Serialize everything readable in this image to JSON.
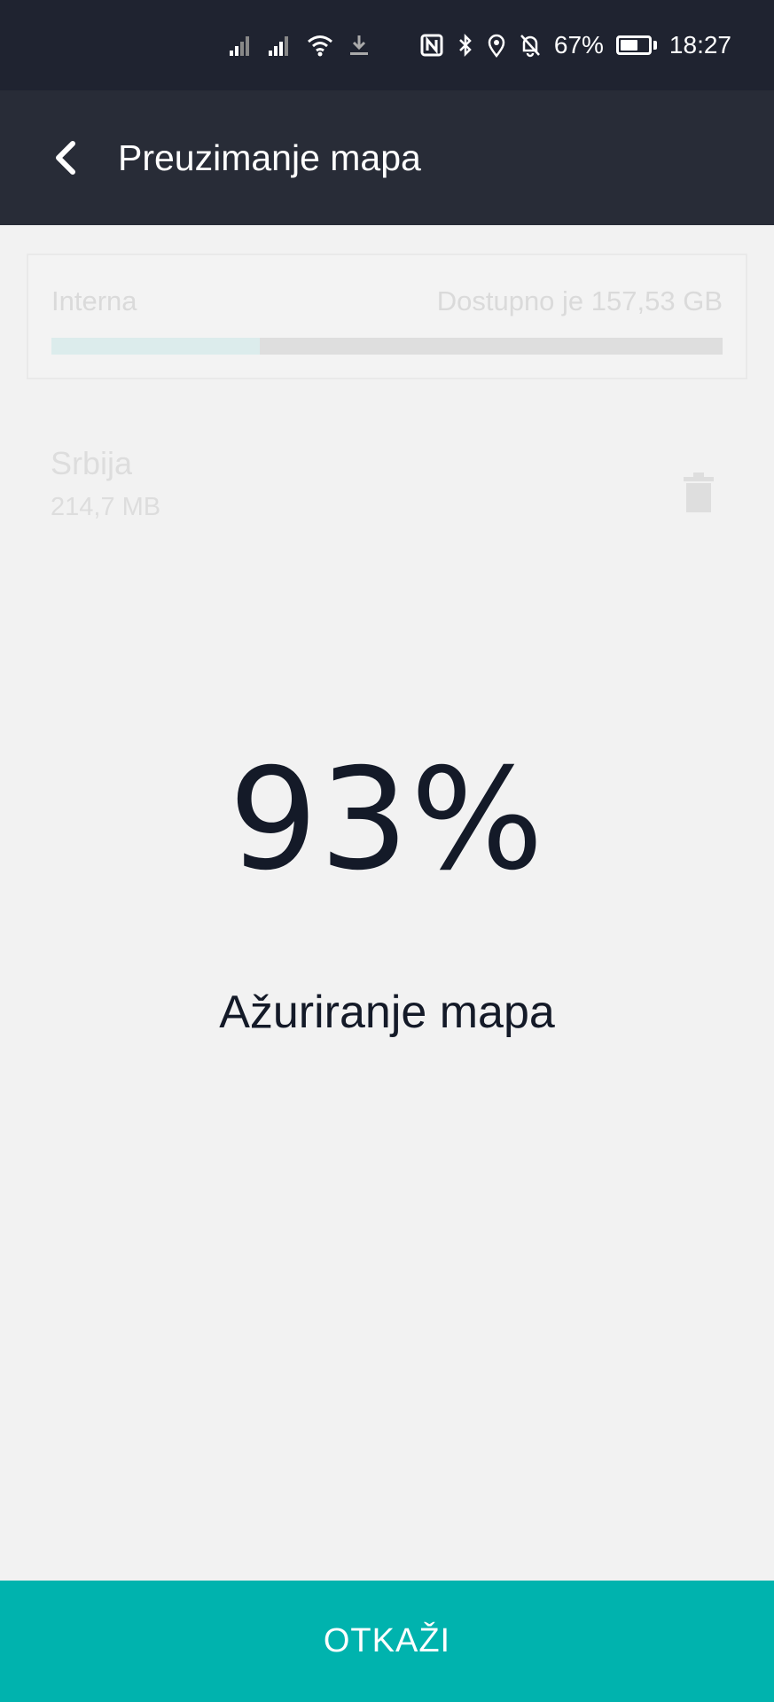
{
  "status_bar": {
    "battery_percent": "67%",
    "battery_level": 0.67,
    "time": "18:27",
    "icons": [
      "signal-icon",
      "signal-icon",
      "wifi-icon",
      "download-icon",
      "nfc-icon",
      "bluetooth-icon",
      "location-icon",
      "notifications-off-icon",
      "battery-icon"
    ]
  },
  "app_bar": {
    "back_icon": "chevron-left-icon",
    "title": "Preuzimanje mapa"
  },
  "storage": {
    "label": "Interna",
    "available": "Dostupno je 157,53 GB",
    "used_fraction": 0.31
  },
  "map_item": {
    "name": "Srbija",
    "size": "214,7 MB",
    "delete_icon": "trash-icon"
  },
  "progress": {
    "percent": "93%",
    "label": "Ažuriranje mapa"
  },
  "cancel": {
    "label": "OTKAŽI"
  },
  "colors": {
    "status_bar_bg": "#1f2330",
    "app_bar_bg": "#282c37",
    "background": "#f2f2f2",
    "accent": "#00b3ae",
    "text_dark": "#141a28"
  }
}
